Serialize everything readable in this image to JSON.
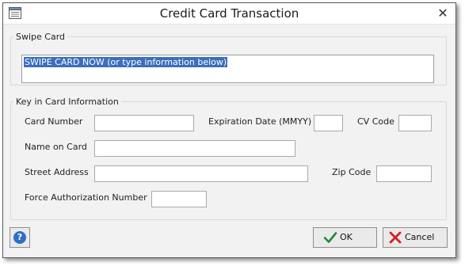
{
  "window": {
    "title": "Credit Card Transaction",
    "close_glyph": "✕"
  },
  "swipe": {
    "legend": "Swipe Card",
    "value": "SWIPE CARD NOW (or type information below)"
  },
  "key_in": {
    "legend": "Key in Card Information",
    "card_number_label": "Card Number",
    "expiration_label": "Expiration Date (MMYY)",
    "cv_code_label": "CV Code",
    "name_label": "Name on Card",
    "street_label": "Street Address",
    "zip_label": "Zip Code",
    "force_auth_label": "Force Authorization Number",
    "card_number": "",
    "expiration": "",
    "cv_code": "",
    "name": "",
    "street": "",
    "zip": "",
    "force_auth": ""
  },
  "buttons": {
    "help_glyph": "?",
    "ok_label": "OK",
    "cancel_label": "Cancel"
  },
  "colors": {
    "selection": "#3b6fbd",
    "ok_icon": "#1f8a3a",
    "cancel_icon": "#d21f1f",
    "help_icon": "#2f6fc4"
  },
  "icons": {
    "window": "window-icon",
    "close": "close-icon",
    "help": "help-icon",
    "ok": "checkmark-icon",
    "cancel": "x-icon"
  }
}
